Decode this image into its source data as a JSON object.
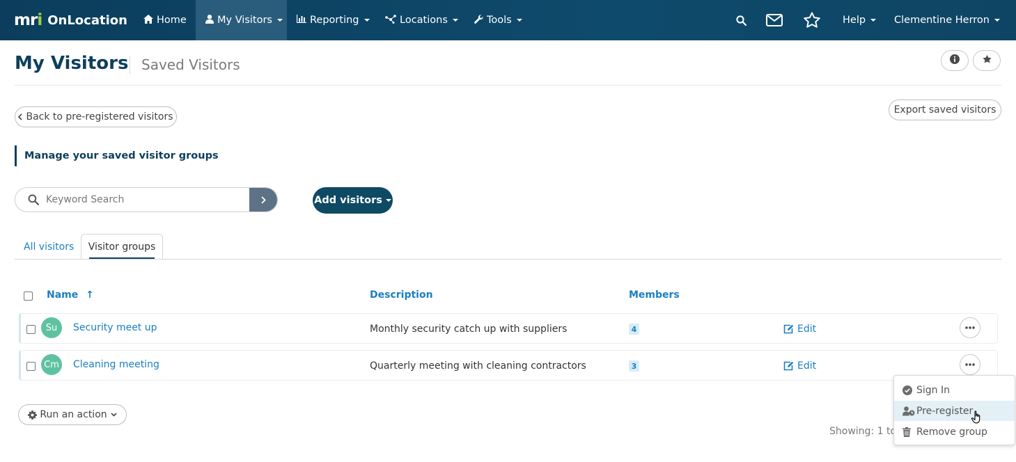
{
  "app": {
    "logo_mark_a": "m",
    "logo_mark_b": "r",
    "logo_mark_c": "i",
    "name": "OnLocation"
  },
  "nav": {
    "items": [
      {
        "label": "Home",
        "icon": "home-icon"
      },
      {
        "label": "My Visitors",
        "icon": "user-icon",
        "active": true
      },
      {
        "label": "Reporting",
        "icon": "bar-chart-icon"
      },
      {
        "label": "Locations",
        "icon": "network-icon"
      },
      {
        "label": "Tools",
        "icon": "wrench-icon"
      }
    ],
    "help_label": "Help",
    "user_name": "Clementine Herron"
  },
  "page": {
    "title": "My Visitors",
    "subtitle": "Saved Visitors"
  },
  "actions": {
    "back_label": "Back to pre-registered visitors",
    "export_label": "Export saved visitors",
    "section_label": "Manage your saved visitor groups",
    "add_visitors_label": "Add visitors",
    "run_action_label": "Run an action"
  },
  "search": {
    "placeholder": "Keyword Search",
    "value": ""
  },
  "tabs": [
    {
      "label": "All visitors",
      "active": false
    },
    {
      "label": "Visitor groups",
      "active": true
    }
  ],
  "table": {
    "headers": {
      "name": "Name",
      "sort_indicator": "↑",
      "description": "Description",
      "members": "Members"
    },
    "edit_label": "Edit",
    "rows": [
      {
        "initials": "Su",
        "name": "Security meet up",
        "description": "Monthly security catch up with suppliers",
        "members": "4"
      },
      {
        "initials": "Cm",
        "name": "Cleaning meeting",
        "description": "Quarterly meeting with cleaning contractors",
        "members": "3"
      }
    ]
  },
  "dropdown": {
    "items": [
      {
        "label": "Sign In",
        "icon": "check-circle-icon"
      },
      {
        "label": "Pre-register",
        "icon": "user-clock-icon",
        "hover": true
      },
      {
        "label": "Remove group",
        "icon": "trash-icon"
      }
    ]
  },
  "footer": {
    "showing_text": "Showing: 1 to"
  },
  "colors": {
    "nav_bg": "#0e4a6c",
    "accent": "#1a7fc1",
    "primary_dark": "#0e3f5c",
    "avatar": "#5ec2a0",
    "logo_accent": "#9fd14a"
  }
}
